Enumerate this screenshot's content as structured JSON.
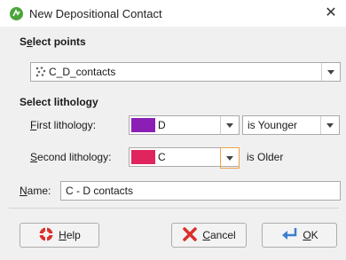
{
  "window": {
    "title": "New Depositional Contact",
    "close_glyph": "✕"
  },
  "select_points": {
    "label_pre": "S",
    "label_ul": "e",
    "label_post": "lect points",
    "value": "C_D_contacts"
  },
  "select_lithology": {
    "label": "Select lithology",
    "first": {
      "label_ul": "F",
      "label_post": "irst lithology:",
      "value": "D",
      "color": "#8b1fb5",
      "relation": "is Younger"
    },
    "second": {
      "label_ul": "S",
      "label_post": "econd lithology:",
      "value": "C",
      "color": "#e0245e",
      "relation": "is Older"
    }
  },
  "name_field": {
    "label_ul": "N",
    "label_post": "ame:",
    "value": "C - D contacts"
  },
  "buttons": {
    "help": {
      "label_ul": "H",
      "label_post": "elp"
    },
    "cancel": {
      "label_ul": "C",
      "label_post": "ancel"
    },
    "ok": {
      "label_ul": "O",
      "label_post": "K"
    }
  },
  "icons": [
    "app-icon",
    "points-icon",
    "help-icon",
    "cancel-icon",
    "ok-icon"
  ]
}
